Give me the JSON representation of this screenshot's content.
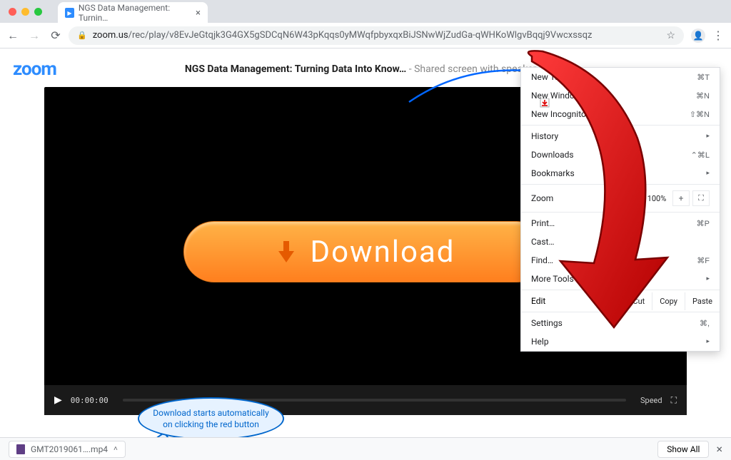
{
  "browser": {
    "tab_title": "NGS Data Management: Turnin…",
    "url_host": "zoom.us",
    "url_path": "/rec/play/v8EvJeGtqjk3G4GX5gSDCqN6W43pKqqs0yMWqfpbyxqxBiJSNwWjZudGa-qWHKoWlgvBqqj9Vwcxssqz"
  },
  "page": {
    "logo_text": "zoom",
    "title_bold": "NGS Data Management: Turning Data Into Know…",
    "title_suffix": " - Shared screen with speaker"
  },
  "video": {
    "timecode": "00:00:00",
    "speed_label": "Speed"
  },
  "download_button": {
    "label": "Download"
  },
  "chrome_menu": {
    "new_tab": "New Tab",
    "new_tab_k": "⌘T",
    "new_window": "New Window",
    "new_window_k": "⌘N",
    "new_incog": "New Incognito Window",
    "new_incog_k": "⇧⌘N",
    "history": "History",
    "downloads": "Downloads",
    "downloads_k": "⌃⌘L",
    "bookmarks": "Bookmarks",
    "zoom": "Zoom",
    "zoom_val": "100%",
    "print": "Print…",
    "print_k": "⌘P",
    "cast": "Cast…",
    "find": "Find…",
    "find_k": "⌘F",
    "more_tools": "More Tools",
    "edit": "Edit",
    "cut": "Cut",
    "copy": "Copy",
    "paste": "Paste",
    "settings": "Settings",
    "settings_k": "⌘,",
    "help": "Help"
  },
  "tooltip": {
    "text": "Download starts automatically on clicking the red button"
  },
  "shelf": {
    "filename": "GMT2019061….mp4",
    "show_all": "Show All"
  }
}
